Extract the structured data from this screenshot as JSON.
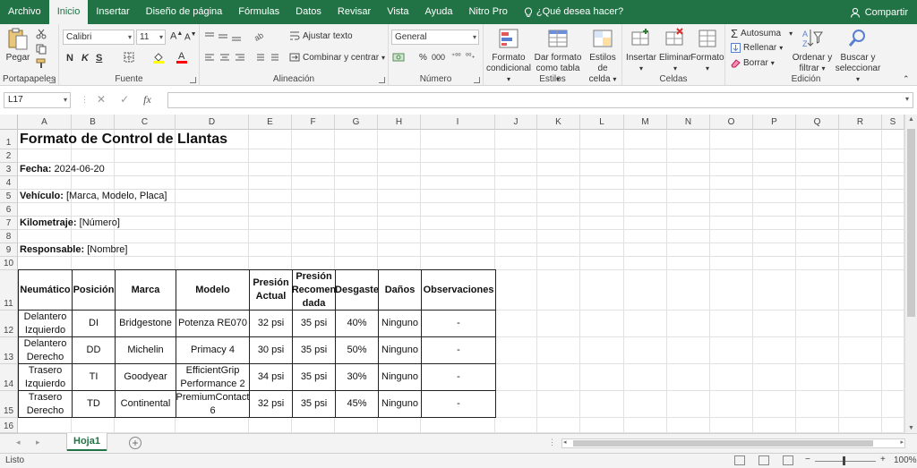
{
  "ribbon": {
    "tabs": [
      "Archivo",
      "Inicio",
      "Insertar",
      "Diseño de página",
      "Fórmulas",
      "Datos",
      "Revisar",
      "Vista",
      "Ayuda",
      "Nitro Pro"
    ],
    "tell_me": "¿Qué desea hacer?",
    "share": "Compartir",
    "clipboard": {
      "paste": "Pegar",
      "label": "Portapapeles"
    },
    "font": {
      "name": "Calibri",
      "size": "11",
      "bold": "N",
      "italic": "K",
      "underline": "S",
      "label": "Fuente"
    },
    "alignment": {
      "wrap": "Ajustar texto",
      "merge": "Combinar y centrar",
      "label": "Alineación"
    },
    "number": {
      "format": "General",
      "percent": "%",
      "thousands": "000",
      "label": "Número"
    },
    "styles": {
      "conditional": [
        "Formato",
        "condicional"
      ],
      "table": [
        "Dar formato",
        "como tabla"
      ],
      "cell": [
        "Estilos de",
        "celda"
      ],
      "label": "Estilos"
    },
    "cells": {
      "insert": "Insertar",
      "delete": "Eliminar",
      "format": "Formato",
      "label": "Celdas"
    },
    "editing": {
      "autosum": "Autosuma",
      "fill": "Rellenar",
      "clear": "Borrar",
      "sort": [
        "Ordenar y",
        "filtrar"
      ],
      "find": [
        "Buscar y",
        "seleccionar"
      ],
      "label": "Edición"
    }
  },
  "formula_bar": {
    "name_box": "L17",
    "fx": "fx",
    "cancel": "✕",
    "enter": "✓",
    "content": ""
  },
  "columns": [
    "A",
    "B",
    "C",
    "D",
    "E",
    "F",
    "G",
    "H",
    "I",
    "J",
    "K",
    "L",
    "M",
    "N",
    "O",
    "P",
    "Q",
    "R",
    "S"
  ],
  "rows": [
    "1",
    "2",
    "3",
    "4",
    "5",
    "6",
    "7",
    "8",
    "9",
    "10",
    "11",
    "12",
    "13",
    "14",
    "15",
    "16"
  ],
  "sheet": {
    "title": "Formato de Control de Llantas",
    "fields": [
      {
        "label": "Fecha:",
        "value": " 2024-06-20"
      },
      {
        "label": "Vehículo:",
        "value": " [Marca, Modelo, Placa]"
      },
      {
        "label": "Kilometraje:",
        "value": " [Número]"
      },
      {
        "label": "Responsable:",
        "value": " [Nombre]"
      }
    ],
    "table_headers": [
      "Neumático",
      "Posición",
      "Marca",
      "Modelo",
      "Presión Actual",
      "Presión Recomendada",
      "Desgaste",
      "Daños",
      "Observaciones"
    ],
    "table_headers_display": [
      [
        "Neumático"
      ],
      [
        "Posición"
      ],
      [
        "Marca"
      ],
      [
        "Modelo"
      ],
      [
        "Presión",
        "Actual"
      ],
      [
        "Presión",
        "Recomen",
        "dada"
      ],
      [
        "Desgaste"
      ],
      [
        "Daños"
      ],
      [
        "Observaciones"
      ]
    ],
    "table_rows": [
      [
        "Delantero Izquierdo",
        "DI",
        "Bridgestone",
        "Potenza RE070",
        "32 psi",
        "35 psi",
        "40%",
        "Ninguno",
        "-"
      ],
      [
        "Delantero Derecho",
        "DD",
        "Michelin",
        "Primacy 4",
        "30 psi",
        "35 psi",
        "50%",
        "Ninguno",
        "-"
      ],
      [
        "Trasero Izquierdo",
        "TI",
        "Goodyear",
        "EfficientGrip Performance 2",
        "34 psi",
        "35 psi",
        "30%",
        "Ninguno",
        "-"
      ],
      [
        "Trasero Derecho",
        "TD",
        "Continental",
        "PremiumContact 6",
        "32 psi",
        "35 psi",
        "45%",
        "Ninguno",
        "-"
      ]
    ],
    "table_rows_display": [
      [
        [
          "Delantero",
          "Izquierdo"
        ],
        [
          "DI"
        ],
        [
          "Bridgestone"
        ],
        [
          "Potenza RE070"
        ],
        [
          "32 psi"
        ],
        [
          "35 psi"
        ],
        [
          "40%"
        ],
        [
          "Ninguno"
        ],
        [
          "-"
        ]
      ],
      [
        [
          "Delantero",
          "Derecho"
        ],
        [
          "DD"
        ],
        [
          "Michelin"
        ],
        [
          "Primacy 4"
        ],
        [
          "30 psi"
        ],
        [
          "35 psi"
        ],
        [
          "50%"
        ],
        [
          "Ninguno"
        ],
        [
          "-"
        ]
      ],
      [
        [
          "Trasero",
          "Izquierdo"
        ],
        [
          "TI"
        ],
        [
          "Goodyear"
        ],
        [
          "EfficientGrip",
          "Performance 2"
        ],
        [
          "34 psi"
        ],
        [
          "35 psi"
        ],
        [
          "30%"
        ],
        [
          "Ninguno"
        ],
        [
          "-"
        ]
      ],
      [
        [
          "Trasero",
          "Derecho"
        ],
        [
          "TD"
        ],
        [
          "Continental"
        ],
        [
          "PremiumContact",
          "6"
        ],
        [
          "32 psi"
        ],
        [
          "35 psi"
        ],
        [
          "45%"
        ],
        [
          "Ninguno"
        ],
        [
          "-"
        ]
      ]
    ]
  },
  "sheet_tabs": [
    {
      "name": "Hoja1",
      "active": true
    }
  ],
  "status": {
    "text": "Listo",
    "zoom": "100%",
    "zoom_minus": "−",
    "zoom_plus": "+"
  },
  "colors": {
    "accent": "#217346",
    "font_highlight": "#ffff00",
    "font_color": "#ff0000"
  }
}
